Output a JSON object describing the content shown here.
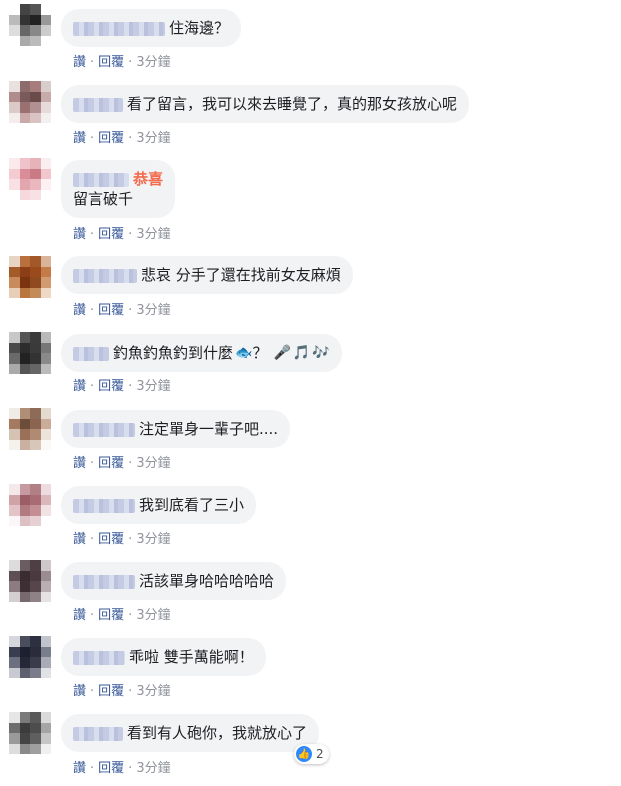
{
  "actions": {
    "like": "讚",
    "reply": "回覆",
    "sep": "·",
    "time": "3分鐘"
  },
  "comments": [
    {
      "text": "住海邊？"
    },
    {
      "text": "看了留言，我可以來去睡覺了，真的那女孩放心呢"
    },
    {
      "name_text": "恭喜",
      "text": "留言破千"
    },
    {
      "text": "悲哀 分手了還在找前女友麻煩"
    },
    {
      "text": "釣魚釣魚釣到什麼",
      "text_after": "？",
      "emoji": [
        "🐟",
        "🎤",
        "🎵",
        "🎶"
      ]
    },
    {
      "text": "注定單身一輩子吧...."
    },
    {
      "text": "我到底看了三小"
    },
    {
      "text": "活該單身哈哈哈哈哈"
    },
    {
      "text": "乖啦 雙手萬能啊！"
    },
    {
      "text": "看到有人砲你，我就放心了",
      "reaction": {
        "icon": "thumbs-up-icon",
        "count": "2"
      }
    }
  ],
  "colors": {
    "bubble_bg": "#f2f3f5",
    "link": "#385898",
    "name_highlight": "#f36b4e",
    "like_blue": "#2e89ff"
  }
}
